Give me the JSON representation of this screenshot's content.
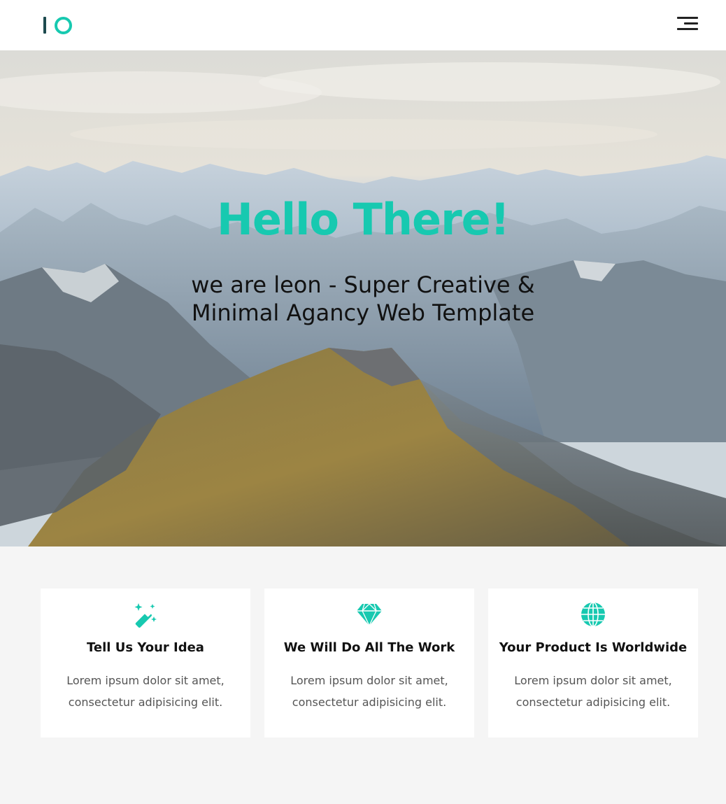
{
  "header": {
    "logo_icon": "io-logo-icon",
    "menu_icon": "hamburger-menu-icon"
  },
  "hero": {
    "title": "Hello There!",
    "subtitle": "we are leon - Super Creative & Minimal Agancy Web Template",
    "background": "mountain-range-photo"
  },
  "features": [
    {
      "icon": "magic-wand-icon",
      "title": "Tell Us Your Idea",
      "text": "Lorem ipsum dolor sit amet, consectetur adipisicing elit."
    },
    {
      "icon": "diamond-icon",
      "title": "We Will Do All The Work",
      "text": "Lorem ipsum dolor sit amet, consectetur adipisicing elit."
    },
    {
      "icon": "globe-icon",
      "title": "Your Product Is Worldwide",
      "text": "Lorem ipsum dolor sit amet, consectetur adipisicing elit."
    }
  ],
  "colors": {
    "accent": "#17c9b0",
    "logo_dark": "#1d4a4f",
    "text_dark": "#111111",
    "text_body": "#555555",
    "section_bg": "#f5f5f5"
  }
}
